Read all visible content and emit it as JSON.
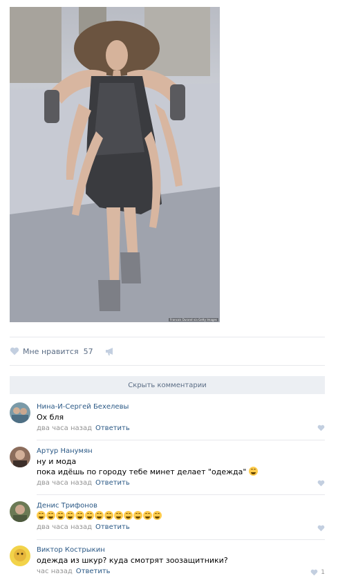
{
  "post": {
    "image_credit": "Francois Durand via Getty Images",
    "like_label": "Мне нравится",
    "like_count": "57"
  },
  "comments_toggle": "Скрыть комментарии",
  "comments": [
    {
      "author": "Нина-И-Сергей Бехелевы",
      "text": "Ох бля",
      "time": "два часа назад",
      "reply": "Ответить",
      "likes": ""
    },
    {
      "author": "Артур Нанумян",
      "text_line1": "ну и мода",
      "text_line2": "пока идёшь по городу тебе минет делает \"одежда\"",
      "time": "два часа назад",
      "reply": "Ответить",
      "likes": ""
    },
    {
      "author": "Денис Трифонов",
      "emoji_count": 13,
      "emoji_name": "face-with-tears-of-joy",
      "time": "два часа назад",
      "reply": "Ответить",
      "likes": ""
    },
    {
      "author": "Виктор Кострыкин",
      "text": "одежда из шкур? куда смотрят зоозащитники?",
      "time": "час назад",
      "reply": "Ответить",
      "likes": "1"
    }
  ],
  "colors": {
    "link": "#2a5885",
    "muted": "#939393",
    "action": "#5b6d85",
    "bar": "#eceff3"
  }
}
